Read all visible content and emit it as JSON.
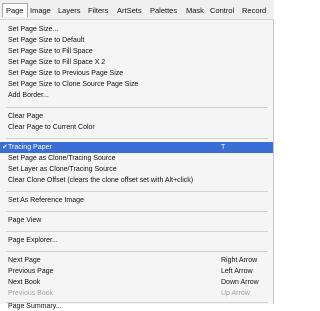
{
  "menubar": {
    "items": [
      "Page",
      "Image",
      "Layers",
      "Filters",
      "ArtSets",
      "Palettes",
      "Mask",
      "Control",
      "Record"
    ]
  },
  "menu": {
    "items": [
      {
        "label": "Set Page Size...",
        "shortcut": ""
      },
      {
        "label": "Set Page Size to Default",
        "shortcut": ""
      },
      {
        "label": "Set Page Size to Fill Space",
        "shortcut": ""
      },
      {
        "label": "Set Page Size to Fill Space X 2",
        "shortcut": ""
      },
      {
        "label": "Set Page Size to Previous Page Size",
        "shortcut": ""
      },
      {
        "label": "Set Page Size to Clone Source Page Size",
        "shortcut": ""
      },
      {
        "label": "Add Border...",
        "shortcut": ""
      },
      {
        "label": "Clear Page",
        "shortcut": ""
      },
      {
        "label": "Clear Page to Current Color",
        "shortcut": ""
      },
      {
        "label": "Tracing Paper",
        "shortcut": "T",
        "checked": true,
        "checkmark": "✔"
      },
      {
        "label": "Set Page as Clone/Tracing Source",
        "shortcut": ""
      },
      {
        "label": "Set Layer as Clone/Tracing Source",
        "shortcut": ""
      },
      {
        "label": "Clear Clone Offset (clears the clone offset set with Alt+click)",
        "shortcut": ""
      },
      {
        "label": "Set As Reference Image",
        "shortcut": ""
      },
      {
        "label": "Page View",
        "shortcut": ""
      },
      {
        "label": "Page Explorer...",
        "shortcut": ""
      },
      {
        "label": "Next Page",
        "shortcut": "Right Arrow"
      },
      {
        "label": "Previous Page",
        "shortcut": "Left Arrow"
      },
      {
        "label": "Next Book",
        "shortcut": "Down Arrow"
      },
      {
        "label": "Previous Book",
        "shortcut": "Up Arrow",
        "disabled": true
      },
      {
        "label": "Page Summary...",
        "shortcut": ""
      }
    ]
  },
  "colors": {
    "selection": "#3a6dd6",
    "menu_background": "#f5f5f5",
    "disabled_text": "#a3a3a3"
  }
}
